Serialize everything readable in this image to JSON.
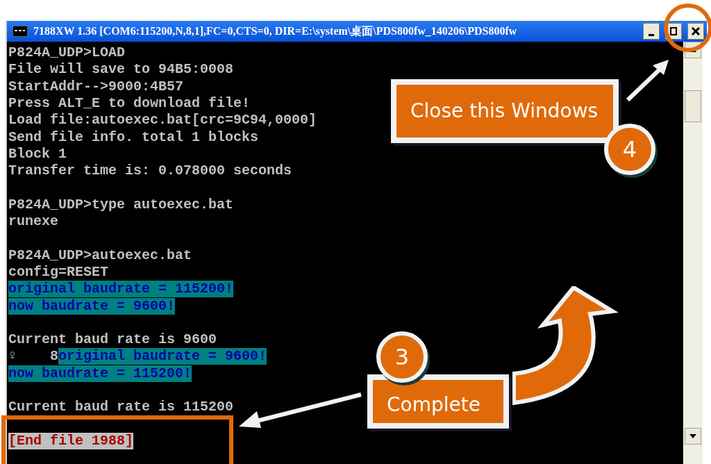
{
  "window": {
    "title": "7188XW 1.36 [COM6:115200,N,8,1],FC=0,CTS=0, DIR=E:\\system\\桌面\\PDS800fw_140206\\PDS800fw"
  },
  "console": {
    "lines": [
      {
        "kind": "text",
        "spans": [
          {
            "text": "P824A_UDP>LOAD",
            "kind": "plain"
          }
        ]
      },
      {
        "kind": "text",
        "spans": [
          {
            "text": "File will save to 94B5:0008",
            "kind": "plain"
          }
        ]
      },
      {
        "kind": "text",
        "spans": [
          {
            "text": "StartAddr-->9000:4B57",
            "kind": "plain"
          }
        ]
      },
      {
        "kind": "text",
        "spans": [
          {
            "text": "Press ALT_E to download file!",
            "kind": "plain"
          }
        ]
      },
      {
        "kind": "text",
        "spans": [
          {
            "text": "Load file:autoexec.bat[crc=9C94,0000]",
            "kind": "plain"
          }
        ]
      },
      {
        "kind": "text",
        "spans": [
          {
            "text": "Send file info. total 1 blocks",
            "kind": "plain"
          }
        ]
      },
      {
        "kind": "text",
        "spans": [
          {
            "text": "Block 1",
            "kind": "plain"
          }
        ]
      },
      {
        "kind": "text",
        "spans": [
          {
            "text": "Transfer time is: 0.078000 seconds",
            "kind": "plain"
          }
        ]
      },
      {
        "kind": "blank"
      },
      {
        "kind": "text",
        "spans": [
          {
            "text": "P824A_UDP>type autoexec.bat",
            "kind": "plain"
          }
        ]
      },
      {
        "kind": "text",
        "spans": [
          {
            "text": "runexe",
            "kind": "plain"
          }
        ]
      },
      {
        "kind": "blank"
      },
      {
        "kind": "text",
        "spans": [
          {
            "text": "P824A_UDP>autoexec.bat",
            "kind": "plain"
          }
        ]
      },
      {
        "kind": "text",
        "spans": [
          {
            "text": "config=RESET",
            "kind": "plain"
          }
        ]
      },
      {
        "kind": "text",
        "spans": [
          {
            "text": "original baudrate = 115200!",
            "kind": "highlight"
          }
        ]
      },
      {
        "kind": "text",
        "spans": [
          {
            "text": "now baudrate = 9600!",
            "kind": "highlight"
          }
        ]
      },
      {
        "kind": "blank"
      },
      {
        "kind": "text",
        "spans": [
          {
            "text": "Current baud rate is 9600",
            "kind": "plain"
          }
        ]
      },
      {
        "kind": "text",
        "spans": [
          {
            "text": "♀    8",
            "kind": "plain"
          },
          {
            "text": "original baudrate = 9600!",
            "kind": "highlight"
          }
        ]
      },
      {
        "kind": "text",
        "spans": [
          {
            "text": "now baudrate = 115200!",
            "kind": "highlight"
          }
        ]
      },
      {
        "kind": "blank"
      },
      {
        "kind": "text",
        "spans": [
          {
            "text": "Current baud rate is 115200",
            "kind": "plain"
          }
        ]
      },
      {
        "kind": "blank"
      },
      {
        "kind": "text",
        "spans": [
          {
            "text": "[End file 1988]",
            "kind": "end"
          }
        ]
      }
    ]
  },
  "callouts": [
    {
      "number": "4",
      "text": "Close this Windows"
    },
    {
      "number": "3",
      "text": "Complete"
    }
  ]
}
